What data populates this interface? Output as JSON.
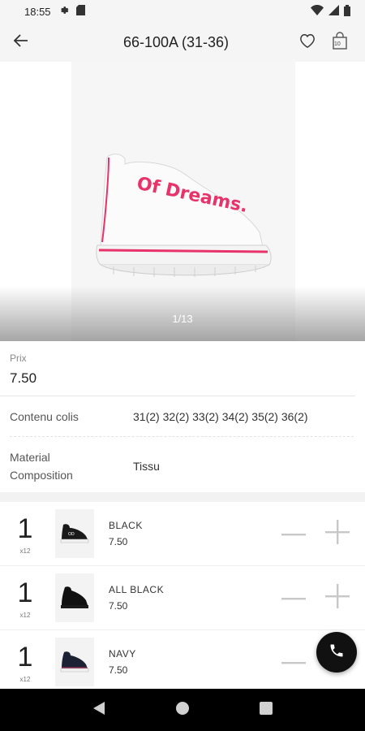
{
  "status_bar": {
    "time": "18:55",
    "icons_left": [
      "settings-icon",
      "sd-card-icon"
    ],
    "icons_right": [
      "wifi-icon",
      "signal-icon",
      "battery-icon"
    ]
  },
  "app_bar": {
    "title": "66-100A (31-36)",
    "cart_badge": "10",
    "icons": [
      "back-arrow-icon",
      "heart-icon",
      "bag-icon"
    ]
  },
  "gallery": {
    "counter": "1/13",
    "print_text": "Of Dreams."
  },
  "details": {
    "price_label": "Prix",
    "price_value": "7.50",
    "colis_label": "Contenu colis",
    "colis_value": "31(2) 32(2) 33(2) 34(2) 35(2) 36(2)",
    "material_label_line1": "Material",
    "material_label_line2": "Composition",
    "material_value": "Tissu"
  },
  "variants": [
    {
      "qty": "1",
      "multiplier": "x12",
      "color": "BLACK",
      "price": "7.50"
    },
    {
      "qty": "1",
      "multiplier": "x12",
      "color": "ALL BLACK",
      "price": "7.50"
    },
    {
      "qty": "1",
      "multiplier": "x12",
      "color": "NAVY",
      "price": "7.50"
    }
  ],
  "colors": {
    "accent_pink": "#e8326a",
    "fab_bg": "#111111",
    "nav_bg": "#000000"
  }
}
